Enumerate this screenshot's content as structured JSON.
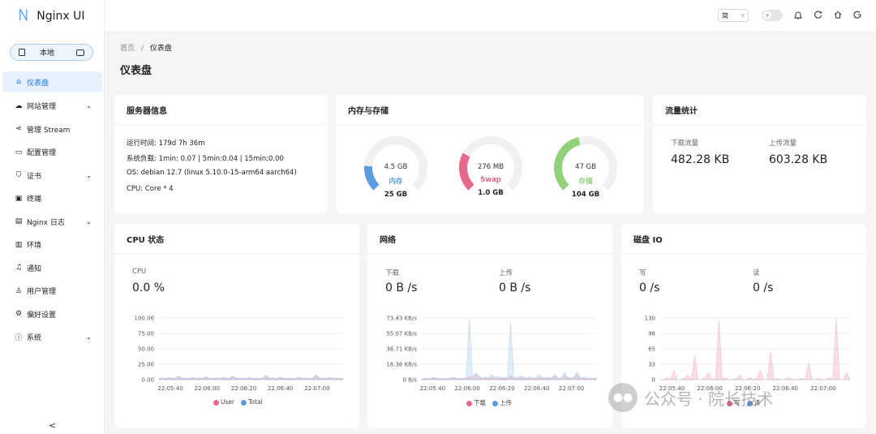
{
  "app": {
    "title": "Nginx UI"
  },
  "sidebar": {
    "env_label": "本地",
    "items": [
      {
        "label": "仪表盘",
        "icon": "home-icon",
        "active": true,
        "chevron": false
      },
      {
        "label": "网站管理",
        "icon": "cloud-icon",
        "active": false,
        "chevron": true
      },
      {
        "label": "管理 Stream",
        "icon": "share-icon",
        "active": false,
        "chevron": false
      },
      {
        "label": "配置管理",
        "icon": "file-icon",
        "active": false,
        "chevron": false
      },
      {
        "label": "证书",
        "icon": "shield-icon",
        "active": false,
        "chevron": true
      },
      {
        "label": "终端",
        "icon": "terminal-icon",
        "active": false,
        "chevron": false
      },
      {
        "label": "Nginx 日志",
        "icon": "file-text-icon",
        "active": false,
        "chevron": true
      },
      {
        "label": "环境",
        "icon": "database-icon",
        "active": false,
        "chevron": false
      },
      {
        "label": "通知",
        "icon": "bell-icon",
        "active": false,
        "chevron": false
      },
      {
        "label": "用户管理",
        "icon": "user-icon",
        "active": false,
        "chevron": false
      },
      {
        "label": "偏好设置",
        "icon": "gear-icon",
        "active": false,
        "chevron": false
      },
      {
        "label": "系统",
        "icon": "info-icon",
        "active": false,
        "chevron": true
      }
    ],
    "collapse_glyph": "<"
  },
  "topbar": {
    "lang": "简",
    "icons": [
      "bell-icon",
      "refresh-icon",
      "home-icon",
      "logout-icon"
    ]
  },
  "breadcrumb": {
    "home": "首页",
    "sep": "/",
    "current": "仪表盘"
  },
  "page_title": "仪表盘",
  "server_info": {
    "title": "服务器信息",
    "lines": [
      "运行时间: 179d 7h 36m",
      "系统负载: 1min: 0.07 | 5min:0.04 | 15min:0.00",
      "OS: debian 12.7 (linux 5.10.0-15-arm64 aarch64)",
      "CPU: Core * 4"
    ]
  },
  "mem_storage": {
    "title": "内存与存储",
    "gauges": [
      {
        "value": "4.5 GB",
        "name": "内存",
        "total": "25 GB",
        "percent": 18,
        "color": "#5b9bdf"
      },
      {
        "value": "276 MB",
        "name": "Swap",
        "total": "1.0 GB",
        "percent": 27,
        "color": "#e8688a"
      },
      {
        "value": "47 GB",
        "name": "存储",
        "total": "104 GB",
        "percent": 45,
        "color": "#92d07a"
      }
    ]
  },
  "traffic": {
    "title": "流量统计",
    "download_label": "下载流量",
    "download_value": "482.28 KB",
    "upload_label": "上传流量",
    "upload_value": "603.28 KB"
  },
  "cpu": {
    "title": "CPU 状态",
    "stat_label": "CPU",
    "stat_value": "0.0 %",
    "legend": [
      "User",
      "Total"
    ]
  },
  "network": {
    "title": "网络",
    "down_label": "下载",
    "down_value": "0 B /s",
    "up_label": "上传",
    "up_value": "0 B /s",
    "legend": [
      "下载",
      "上传"
    ]
  },
  "disk": {
    "title": "磁盘 IO",
    "write_label": "写",
    "write_value": "0 /s",
    "read_label": "读",
    "read_value": "0 /s",
    "legend": [
      "写",
      "读"
    ]
  },
  "chart_data": [
    {
      "type": "area",
      "yticks": [
        "100.00",
        "75.00",
        "50.00",
        "25.00",
        "0.00"
      ],
      "xticks": [
        "22:05:40",
        "22:06:00",
        "22:06:20",
        "22:06:40",
        "22:07:00"
      ],
      "ylim": [
        0,
        100
      ],
      "series": [
        {
          "name": "User",
          "color": "#e8688a",
          "values": [
            1,
            2,
            1,
            3,
            1,
            2,
            5,
            1,
            2,
            1,
            3,
            1,
            2,
            1,
            4,
            2,
            1,
            2,
            1,
            3,
            2,
            1,
            5,
            2,
            1,
            2,
            1,
            3,
            1,
            2,
            1,
            2,
            6,
            1,
            2,
            1,
            3,
            2,
            1,
            2,
            1,
            2,
            3,
            1,
            2,
            1,
            2,
            7,
            1,
            2,
            1,
            3,
            1,
            2,
            1,
            1
          ]
        },
        {
          "name": "Total",
          "color": "#5b9bdf",
          "values": [
            2,
            3,
            2,
            4,
            2,
            3,
            6,
            2,
            3,
            2,
            4,
            2,
            3,
            2,
            5,
            3,
            2,
            3,
            2,
            4,
            3,
            2,
            6,
            3,
            2,
            3,
            2,
            4,
            2,
            3,
            2,
            3,
            7,
            2,
            3,
            2,
            4,
            3,
            2,
            3,
            2,
            3,
            4,
            2,
            3,
            2,
            3,
            8,
            2,
            3,
            2,
            4,
            2,
            3,
            2,
            2
          ]
        }
      ]
    },
    {
      "type": "area",
      "yticks": [
        "73.43 KB/s",
        "55.07 KB/s",
        "36.71 KB/s",
        "18.36 KB/s",
        "0 B/s"
      ],
      "xticks": [
        "22:05:40",
        "22:06:00",
        "22:06:20",
        "22:06:40",
        "22:07:00"
      ],
      "ylim": [
        0,
        73.43
      ],
      "series": [
        {
          "name": "下载",
          "color": "#e8688a",
          "values": [
            0.5,
            1,
            0.5,
            1,
            2,
            1,
            0.5,
            1,
            0.5,
            1,
            2,
            1,
            0.5,
            1,
            1,
            4,
            2,
            6,
            3,
            1,
            2,
            1,
            3,
            1,
            2,
            1,
            2,
            1,
            5,
            2,
            1,
            3,
            2,
            1,
            2,
            1,
            1,
            3,
            2,
            1,
            2,
            1,
            4,
            1,
            1,
            5,
            2,
            1,
            2,
            6,
            1,
            2,
            1,
            1,
            1,
            1
          ]
        },
        {
          "name": "上传",
          "color": "#5b9bdf",
          "values": [
            1,
            2,
            1,
            2,
            3,
            2,
            1,
            2,
            1,
            2,
            3,
            2,
            1,
            2,
            2,
            72,
            4,
            8,
            5,
            2,
            3,
            2,
            6,
            3,
            4,
            2,
            3,
            2,
            68,
            4,
            2,
            5,
            3,
            2,
            4,
            2,
            3,
            6,
            3,
            2,
            3,
            2,
            7,
            2,
            2,
            9,
            3,
            2,
            3,
            10,
            2,
            3,
            2,
            2,
            2,
            2
          ]
        }
      ]
    },
    {
      "type": "area",
      "yticks": [
        "130",
        "98",
        "65",
        "33",
        "0"
      ],
      "xticks": [
        "22:05:40",
        "22:06:00",
        "22:06:20",
        "22:06:40",
        "22:07:00"
      ],
      "ylim": [
        0,
        130
      ],
      "series": [
        {
          "name": "写",
          "color": "#e8688a",
          "values": [
            0,
            0,
            5,
            0,
            20,
            0,
            0,
            3,
            10,
            0,
            50,
            0,
            0,
            5,
            15,
            2,
            0,
            125,
            0,
            4,
            0,
            0,
            2,
            10,
            0,
            0,
            5,
            0,
            3,
            20,
            0,
            0,
            60,
            0,
            2,
            0,
            0,
            5,
            2,
            0,
            0,
            3,
            0,
            35,
            0,
            0,
            2,
            0,
            0,
            5,
            0,
            130,
            0,
            0,
            15,
            0
          ]
        },
        {
          "name": "读",
          "color": "#5b9bdf",
          "values": [
            0,
            0,
            0,
            0,
            0,
            0,
            0,
            0,
            0,
            0,
            0,
            0,
            0,
            0,
            0,
            0,
            0,
            0,
            0,
            0,
            0,
            0,
            0,
            0,
            0,
            0,
            0,
            0,
            0,
            0,
            0,
            0,
            0,
            0,
            0,
            0,
            0,
            0,
            0,
            0,
            0,
            0,
            0,
            0,
            0,
            0,
            0,
            0,
            0,
            0,
            0,
            0,
            0,
            0,
            0,
            0
          ]
        }
      ]
    }
  ],
  "watermark": {
    "text": "公众号 · 院长技术"
  }
}
